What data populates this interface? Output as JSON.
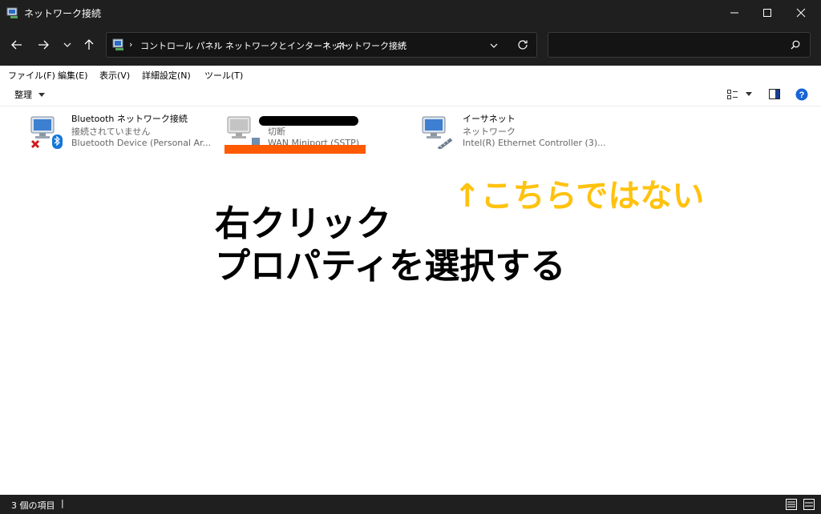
{
  "window": {
    "title": "ネットワーク接続"
  },
  "address": {
    "crumbs": [
      "コントロール パネル",
      "ネットワークとインターネット",
      "ネットワーク接続"
    ],
    "search_placeholder": ""
  },
  "menu": {
    "items": [
      "ファイル(F)",
      "編集(E)",
      "表示(V)",
      "詳細設定(N)",
      "ツール(T)"
    ]
  },
  "toolbar": {
    "organize_label": "整理"
  },
  "connections": [
    {
      "name": "Bluetooth ネットワーク接続",
      "status": "接続されていません",
      "device": "Bluetooth Device (Personal Ar..."
    },
    {
      "name": "",
      "status": "切断",
      "device": "WAN Miniport (SSTP)"
    },
    {
      "name": "イーサネット",
      "status": "ネットワーク",
      "device": "Intel(R) Ethernet Controller (3)..."
    }
  ],
  "annotations": {
    "not_this": "↑こちらではない",
    "line1": "右クリック",
    "line2": "プロパティを選択する"
  },
  "status": {
    "item_count": "3 個の項目"
  },
  "colors": {
    "annotation_yellow": "#ffc20e",
    "highlight_orange": "#ff5a00"
  }
}
